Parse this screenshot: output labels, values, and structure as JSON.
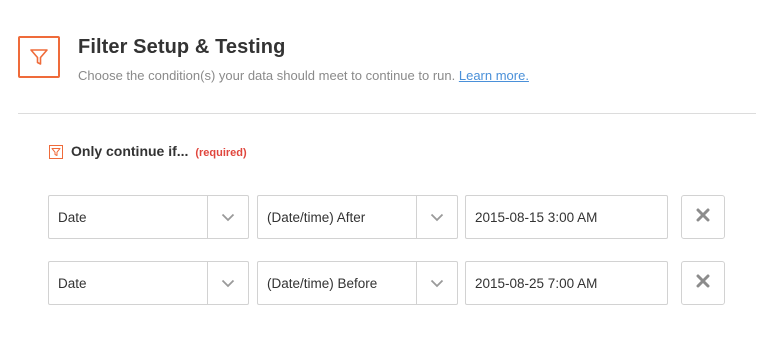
{
  "header": {
    "title": "Filter Setup & Testing",
    "subtitle": "Choose the condition(s) your data should meet to continue to run.",
    "learn_more": "Learn more."
  },
  "section": {
    "title": "Only continue if...",
    "required": "(required)"
  },
  "conditions": [
    {
      "field": "Date",
      "operator": "(Date/time) After",
      "value": "2015-08-15 3:00 AM"
    },
    {
      "field": "Date",
      "operator": "(Date/time) Before",
      "value": "2015-08-25 7:00 AM"
    }
  ],
  "icons": {
    "header": "filter-funnel-icon",
    "section": "filter-funnel-small-icon",
    "dropdown": "chevron-down-icon",
    "remove": "close-x-icon"
  },
  "colors": {
    "accent": "#ef6b3a",
    "link": "#4a90d9",
    "required": "#e0463d"
  }
}
